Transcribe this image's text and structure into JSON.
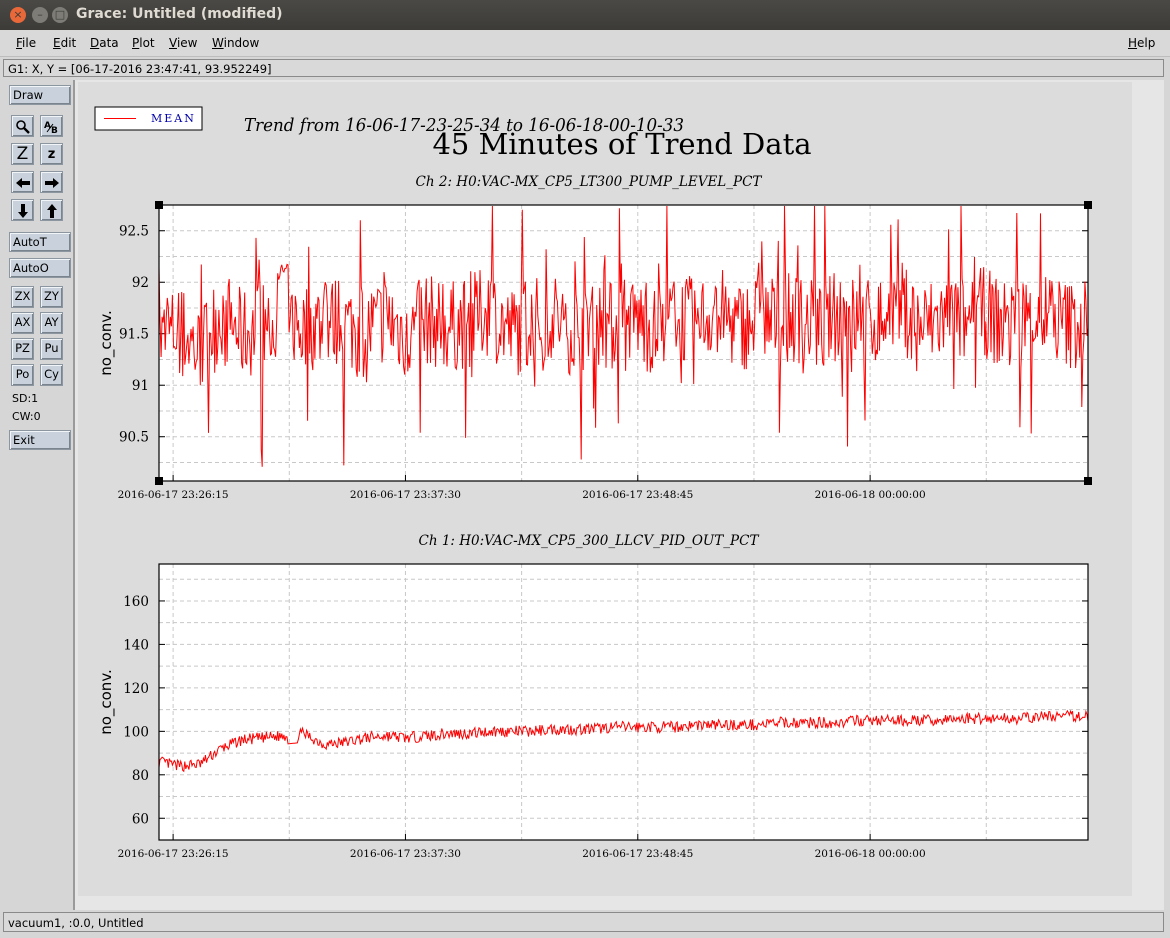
{
  "window": {
    "title": "Grace: Untitled (modified)",
    "close_glyph": "×",
    "min_glyph": "–",
    "max_glyph": "□"
  },
  "menubar": {
    "items": [
      {
        "label": "File",
        "u": "F",
        "rest": "ile"
      },
      {
        "label": "Edit",
        "u": "E",
        "rest": "dit"
      },
      {
        "label": "Data",
        "u": "D",
        "rest": "ata"
      },
      {
        "label": "Plot",
        "u": "P",
        "rest": "lot"
      },
      {
        "label": "View",
        "u": "V",
        "rest": "iew"
      },
      {
        "label": "Window",
        "u": "W",
        "rest": "indow"
      }
    ],
    "help": {
      "label": "Help",
      "u": "H",
      "rest": "elp"
    }
  },
  "locator": {
    "text": "G1: X, Y = [06-17-2016 23:47:41, 93.952249]"
  },
  "toolbar": {
    "draw": "Draw",
    "autot": "AutoT",
    "autoo": "AutoO",
    "zx": "ZX",
    "zy": "ZY",
    "ax": "AX",
    "ay": "AY",
    "pz": "PZ",
    "pu": "Pu",
    "po": "Po",
    "cy": "Cy",
    "sd": "SD:1",
    "cw": "CW:0",
    "exit": "Exit",
    "z_big": "Z",
    "z_small": "z"
  },
  "status": {
    "text": "vacuum1, :0.0, Untitled"
  },
  "plot": {
    "main_title": "45 Minutes of Trend Data",
    "trend_title": "Trend from 16-06-17-23-25-34 to 16-06-18-00-10-33",
    "legend": "MEAN",
    "line_color": "#ff0000",
    "frame_color": "#000000",
    "grid_color": "#c8c8c8"
  },
  "chart_data": [
    {
      "type": "line",
      "title": "Ch 2: H0:VAC-MX_CP5_LT300_PUMP_LEVEL_PCT",
      "ylabel": "no_conv.",
      "xlabel": "",
      "x_ticks": [
        "2016-06-17 23:26:15",
        "2016-06-17 23:37:30",
        "2016-06-17 23:48:45",
        "2016-06-18 00:00:00"
      ],
      "x_range": [
        "2016-06-17 23:25:34",
        "2016-06-18 00:10:33"
      ],
      "y_ticks": [
        90.5,
        91,
        91.5,
        92,
        92.5
      ],
      "ylim": [
        90.07,
        92.75
      ],
      "grid": true,
      "series": [
        {
          "name": "MEAN",
          "x": [
            0,
            1,
            2,
            3,
            4,
            5,
            6,
            7,
            8,
            9,
            10,
            11,
            12,
            13,
            14,
            15,
            16,
            17,
            18,
            19,
            20,
            21,
            22,
            23,
            24,
            25,
            26,
            27,
            28,
            29,
            30,
            31,
            32,
            33,
            34,
            35,
            36,
            37,
            38,
            39,
            40,
            41,
            42,
            43,
            44,
            45
          ],
          "y": [
            91.0,
            91.6,
            90.6,
            92.2,
            91.3,
            91.6,
            92.1,
            91.5,
            91.9,
            91.7,
            91.4,
            92.0,
            91.3,
            91.9,
            91.6,
            91.8,
            92.3,
            91.4,
            91.7,
            92.1,
            91.5,
            91.9,
            91.6,
            92.0,
            91.4,
            92.1,
            91.7,
            92.3,
            91.6,
            91.9,
            91.8,
            92.0,
            91.5,
            92.2,
            91.7,
            91.9,
            92.4,
            91.6,
            92.0,
            91.8,
            92.2,
            91.6,
            91.9,
            92.1,
            91.7,
            91.8
          ]
        }
      ]
    },
    {
      "type": "line",
      "title": "Ch 1: H0:VAC-MX_CP5_300_LLCV_PID_OUT_PCT",
      "ylabel": "no_conv.",
      "xlabel": "",
      "x_ticks": [
        "2016-06-17 23:26:15",
        "2016-06-17 23:37:30",
        "2016-06-17 23:48:45",
        "2016-06-18 00:00:00"
      ],
      "x_range": [
        "2016-06-17 23:25:34",
        "2016-06-18 00:10:33"
      ],
      "y_ticks": [
        60,
        80,
        100,
        120,
        140,
        160
      ],
      "ylim": [
        50,
        177
      ],
      "grid": true,
      "series": [
        {
          "name": "MEAN",
          "x": [
            0,
            1,
            2,
            3,
            4,
            5,
            6,
            7,
            8,
            9,
            10,
            11,
            12,
            13,
            14,
            15,
            16,
            17,
            18,
            19,
            20,
            21,
            22,
            23,
            24,
            25,
            26,
            27,
            28,
            29,
            30,
            31,
            32,
            33,
            34,
            35,
            36,
            37,
            38,
            39,
            40,
            41,
            42,
            43,
            44,
            45
          ],
          "y": [
            86,
            84,
            85,
            92,
            96,
            97,
            98,
            99,
            94,
            95,
            97,
            98,
            97,
            98,
            99,
            99,
            100,
            100,
            100,
            101,
            101,
            101,
            102,
            102,
            102,
            102,
            103,
            103,
            103,
            103,
            104,
            104,
            104,
            104,
            105,
            105,
            105,
            105,
            105,
            106,
            106,
            106,
            106,
            107,
            107,
            107
          ]
        }
      ]
    }
  ]
}
